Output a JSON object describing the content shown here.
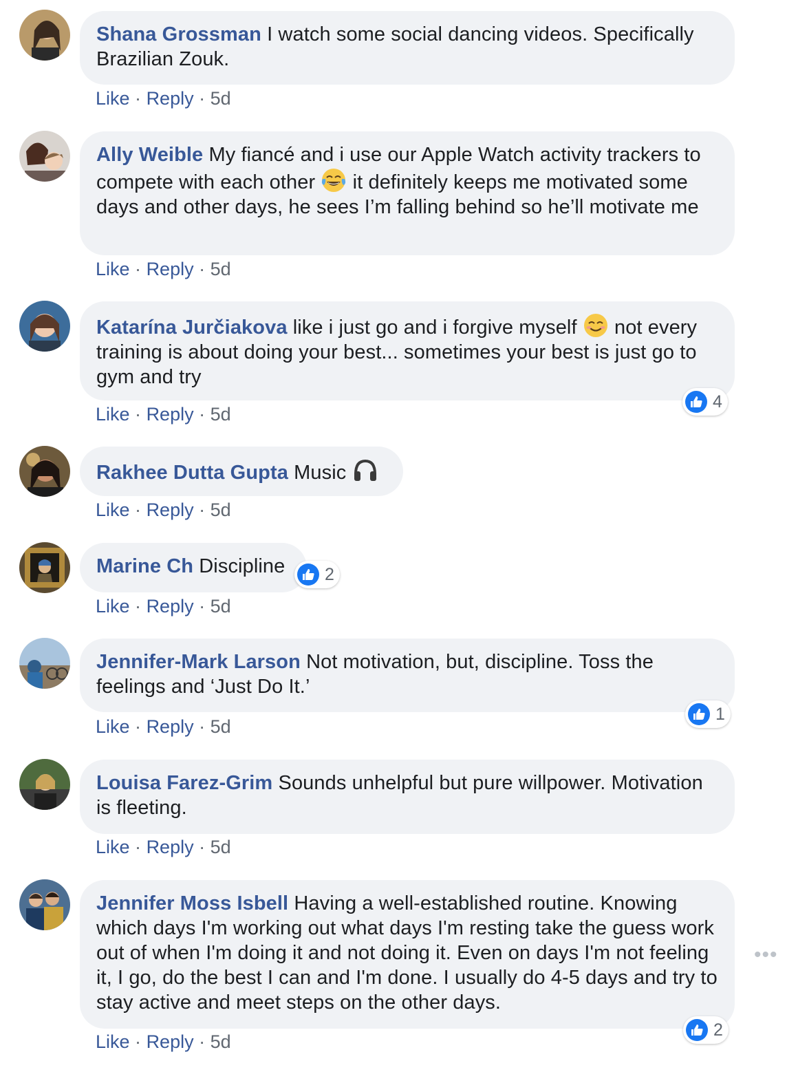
{
  "comments": [
    {
      "author": "Shana Grossman",
      "text": "I watch some social dancing videos. Specifically Brazilian Zouk.",
      "like": "Like",
      "reply": "Reply",
      "time": "5d",
      "sep": "·"
    },
    {
      "author": "Ally Weible",
      "text_a": "My fiancé and i use our Apple Watch activity trackers to compete with each other",
      "text_b": "it definitely keeps me motivated some days and other days, he sees I’m falling behind so he’ll motivate me",
      "like": "Like",
      "reply": "Reply",
      "time": "5d",
      "sep": "·"
    },
    {
      "author": "Katarína Jurčiakova",
      "text_a": "like i just go and i forgive myself",
      "text_b": "not every training is about doing your best... sometimes your best is just go to gym and try",
      "like": "Like",
      "reply": "Reply",
      "time": "5d",
      "sep": "·",
      "reactions": "4"
    },
    {
      "author": "Rakhee Dutta Gupta",
      "text": "Music",
      "like": "Like",
      "reply": "Reply",
      "time": "5d",
      "sep": "·"
    },
    {
      "author": "Marine Ch",
      "text": "Discipline",
      "like": "Like",
      "reply": "Reply",
      "time": "5d",
      "sep": "·",
      "reactions": "2"
    },
    {
      "author": "Jennifer-Mark Larson",
      "text": "Not motivation, but, discipline. Toss the feelings and ‘Just Do It.’",
      "like": "Like",
      "reply": "Reply",
      "time": "5d",
      "sep": "·",
      "reactions": "1"
    },
    {
      "author": "Louisa Farez-Grim",
      "text": "Sounds unhelpful but pure willpower. Motivation is fleeting.",
      "like": "Like",
      "reply": "Reply",
      "time": "5d",
      "sep": "·"
    },
    {
      "author": "Jennifer Moss Isbell",
      "text": "Having a well-established routine. Knowing which days I'm working out what days I'm resting take the guess work out of when I'm doing it and not doing it. Even on days I'm not feeling it, I go, do the best I can and I'm done. I usually do 4-5 days and try to stay active and meet steps on the other days.",
      "like": "Like",
      "reply": "Reply",
      "time": "5d",
      "sep": "·",
      "reactions": "2"
    }
  ],
  "more_options": "•••",
  "icons": {
    "reaction": "thumbs-up-icon",
    "emoji_laugh": "tears-of-joy-emoji",
    "emoji_smile": "smiling-face-emoji",
    "emoji_music": "headphones-emoji",
    "more": "more-options-icon"
  },
  "colors": {
    "author": "#385898",
    "bubble": "#f0f2f5",
    "like_badge": "#1877f2",
    "meta": "#606770"
  }
}
